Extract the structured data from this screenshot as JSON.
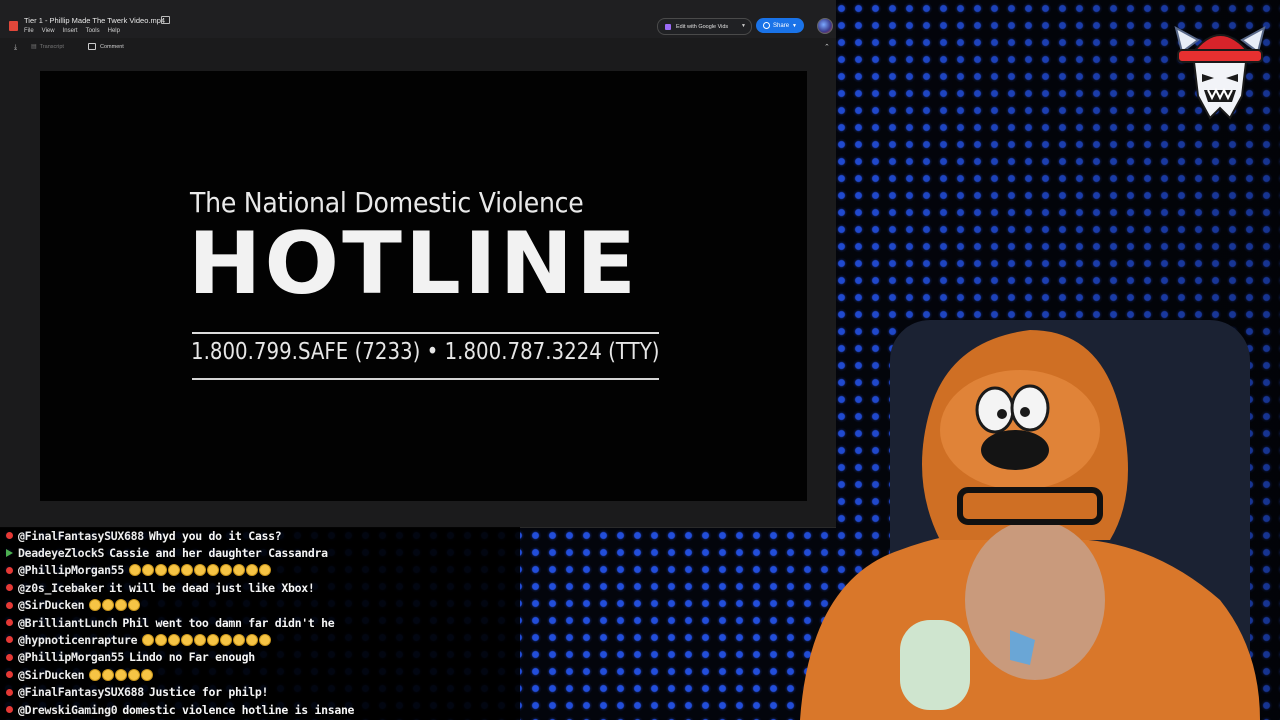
{
  "window": {
    "file_title": "Tier 1 - Phillip Made The Twerk Video.mp4",
    "menu": [
      "File",
      "View",
      "Insert",
      "Tools",
      "Help"
    ],
    "edit_button": "Edit with Google Vids",
    "share_button": "Share",
    "toolbar": {
      "transcript": "Transcript",
      "comment": "Comment"
    }
  },
  "video": {
    "subtitle": "The National Domestic Violence",
    "title": "HOTLINE",
    "numbers": "1.800.799.SAFE (7233) • 1.800.787.3224 (TTY)"
  },
  "colors": {
    "share_blue": "#1a73e8",
    "led_blue": "#2a5aff",
    "badge_red": "#e53935",
    "badge_green": "#4caf50"
  },
  "chat": [
    {
      "badge": "red",
      "user": "@FinalFantasySUX688",
      "message": "Whyd you do it Cass?"
    },
    {
      "badge": "green",
      "user": "DeadeyeZlockS",
      "message": "Cassie and her daughter Cassandra"
    },
    {
      "badge": "red",
      "user": "@PhillipMorgan55",
      "message": "",
      "emoji_count": 11
    },
    {
      "badge": "red",
      "user": "@z0s_Icebaker",
      "message": "it will be dead just like Xbox!"
    },
    {
      "badge": "red",
      "user": "@SirDucken",
      "message": "",
      "emoji_count": 4
    },
    {
      "badge": "red",
      "user": "@BrilliantLunch",
      "message": "Phil went too damn far didn't he"
    },
    {
      "badge": "red",
      "user": "@hypnoticenrapture",
      "message": "",
      "emoji_count": 10
    },
    {
      "badge": "red",
      "user": "@PhillipMorgan55",
      "message": "Lindo no Far enough"
    },
    {
      "badge": "red",
      "user": "@SirDucken",
      "message": "",
      "emoji_count": 5
    },
    {
      "badge": "red",
      "user": "@FinalFantasySUX688",
      "message": "Justice for philp!"
    },
    {
      "badge": "red",
      "user": "@DrewskiGaming0",
      "message": "domestic violence hotline is insane"
    }
  ]
}
